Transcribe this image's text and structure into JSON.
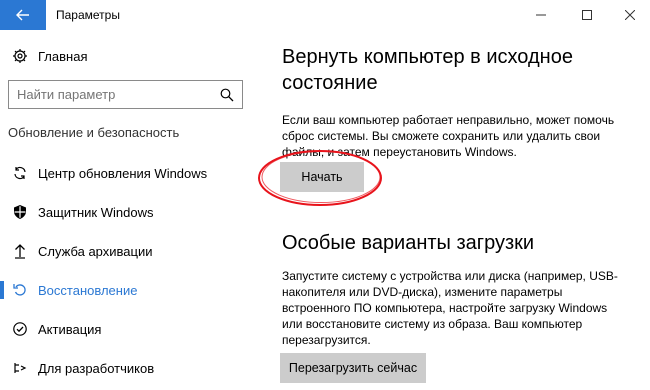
{
  "window": {
    "title": "Параметры",
    "back_icon": "arrow-left-icon",
    "accent_color": "#2b78d3"
  },
  "sidebar": {
    "home_label": "Главная",
    "search": {
      "placeholder": "Найти параметр"
    },
    "section_title": "Обновление и безопасность",
    "items": [
      {
        "label": "Центр обновления Windows",
        "icon": "sync-icon"
      },
      {
        "label": "Защитник Windows",
        "icon": "shield-icon"
      },
      {
        "label": "Служба архивации",
        "icon": "backup-arrow-icon"
      },
      {
        "label": "Восстановление",
        "icon": "recovery-icon",
        "active": true
      },
      {
        "label": "Активация",
        "icon": "check-circle-icon"
      },
      {
        "label": "Для разработчиков",
        "icon": "developer-icon"
      }
    ]
  },
  "main": {
    "reset": {
      "title_line1": "Вернуть компьютер в исходное",
      "title_line2": "состояние",
      "desc_line1": "Если ваш компьютер работает неправильно, может помочь",
      "desc_line2": "сброс системы. Вы сможете сохранить или удалить свои",
      "desc_line3": "файлы, и затем переустановить Windows.",
      "button_label": "Начать"
    },
    "advanced": {
      "title": "Особые варианты загрузки",
      "desc_line1": "Запустите систему с устройства или диска (например, USB-",
      "desc_line2": "накопителя или DVD-диска), измените параметры",
      "desc_line3": "встроенного ПО компьютера, настройте загрузку Windows",
      "desc_line4": "или восстановите систему из образа. Ваш компьютер",
      "desc_line5": "перезагрузится.",
      "button_label": "Перезагрузить сейчас"
    }
  },
  "annotation_color": "#e8141c"
}
